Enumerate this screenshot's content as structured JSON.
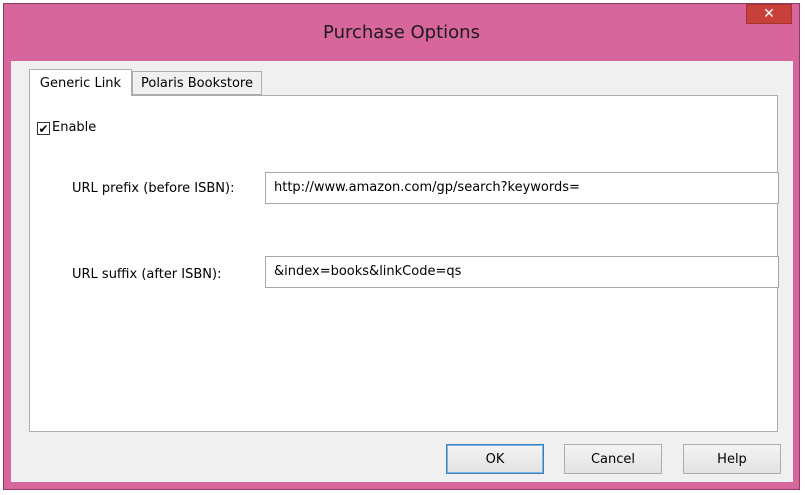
{
  "window": {
    "title": "Purchase Options",
    "close_glyph": "✕"
  },
  "tabs": [
    {
      "label": "Generic Link",
      "active": true
    },
    {
      "label": "Polaris Bookstore",
      "active": false
    }
  ],
  "generic_link": {
    "enable": {
      "label": "Enable",
      "checked": true,
      "glyph": "✔"
    },
    "url_prefix": {
      "label": "URL prefix (before ISBN):",
      "value": "http://www.amazon.com/gp/search?keywords="
    },
    "url_suffix": {
      "label": "URL suffix (after ISBN):",
      "value": "&index=books&linkCode=qs"
    }
  },
  "buttons": {
    "ok": "OK",
    "cancel": "Cancel",
    "help": "Help"
  },
  "colors": {
    "frame": "#d7669c",
    "close": "#c7413a",
    "client": "#f0f0f0"
  }
}
